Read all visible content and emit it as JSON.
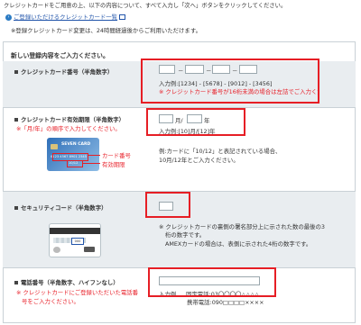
{
  "intro": {
    "instruction": "クレジットカードをご用意の上、以下の内容について、すべて入力し「次へ」ボタンをクリックしてください。",
    "card_list_link": "ご登録いただけるクレジットカード一覧",
    "note": "※登録クレジットカード変更は、24時間経過後からご利用いただけます。"
  },
  "form": {
    "section_title": "新しい登録内容をご入力ください。",
    "card_number": {
      "label": "クレジットカード番号（半角数字）",
      "separator": "－",
      "example": "入力例:[1234] - [5678] - [9012] - [3456]",
      "warning": "※ クレジットカード番号が16桁未満の場合は左詰でご入力ください"
    },
    "expiry": {
      "label": "クレジットカード有効期限（半角数字）",
      "note": "※「月/年」の順序で入力してください。",
      "month_unit": "月/",
      "year_unit": "年",
      "example": "入力例:[10]月/[12]年",
      "card_number_callout": "カード番号",
      "expiry_callout": "有効期限",
      "card_brand": "SEVEN CARD",
      "card_digits": "0123 4567 8901 2345",
      "card_expiry": "10/12",
      "explain_line1": "例:カードに「10/12」と表記されている場合、",
      "explain_line2": "10月/12年とご入力ください。"
    },
    "security": {
      "label": "セキュリティコード（半角数字）",
      "back_code": "000",
      "help_line1": "※ クレジットカードの裏側の署名部分上に示された数の最後の3",
      "help_line2": "桁の数字です。",
      "help_line3": "AMEXカードの場合は、表側に示された4桁の数字です。"
    },
    "phone": {
      "label": "電話番号（半角数字、ハイフンなし）",
      "note_line1": "※ クレジットカードにご登録いただいた電話番",
      "note_line2": "号をご入力ください。",
      "example_label": "入力例",
      "example_landline": "固定電話:03〇〇〇〇△△△△",
      "example_mobile": "携帯電話:090□□□□××××"
    }
  },
  "colors": {
    "accent_red": "#e61e25",
    "row_background": "#e9edf0",
    "link_blue": "#2255aa"
  }
}
